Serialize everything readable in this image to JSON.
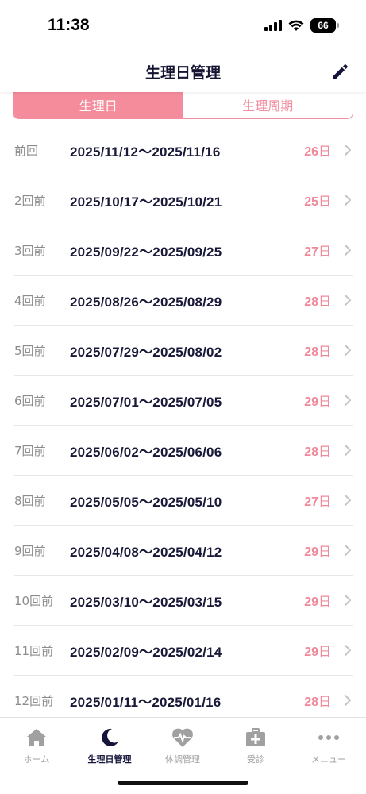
{
  "status": {
    "time": "11:38",
    "battery": "66"
  },
  "header": {
    "title": "生理日管理"
  },
  "segments": {
    "active": "生理日",
    "inactive": "生理周期"
  },
  "records": [
    {
      "label": "前回",
      "range": "2025/11/12〜2025/11/16",
      "days": "26",
      "unit": "日"
    },
    {
      "label": "2回前",
      "range": "2025/10/17〜2025/10/21",
      "days": "25",
      "unit": "日"
    },
    {
      "label": "3回前",
      "range": "2025/09/22〜2025/09/25",
      "days": "27",
      "unit": "日"
    },
    {
      "label": "4回前",
      "range": "2025/08/26〜2025/08/29",
      "days": "28",
      "unit": "日"
    },
    {
      "label": "5回前",
      "range": "2025/07/29〜2025/08/02",
      "days": "28",
      "unit": "日"
    },
    {
      "label": "6回前",
      "range": "2025/07/01〜2025/07/05",
      "days": "29",
      "unit": "日"
    },
    {
      "label": "7回前",
      "range": "2025/06/02〜2025/06/06",
      "days": "28",
      "unit": "日"
    },
    {
      "label": "8回前",
      "range": "2025/05/05〜2025/05/10",
      "days": "27",
      "unit": "日"
    },
    {
      "label": "9回前",
      "range": "2025/04/08〜2025/04/12",
      "days": "29",
      "unit": "日"
    },
    {
      "label": "10回前",
      "range": "2025/03/10〜2025/03/15",
      "days": "29",
      "unit": "日"
    },
    {
      "label": "11回前",
      "range": "2025/02/09〜2025/02/14",
      "days": "29",
      "unit": "日"
    },
    {
      "label": "12回前",
      "range": "2025/01/11〜2025/01/16",
      "days": "28",
      "unit": "日"
    }
  ],
  "tabbar": {
    "home": "ホーム",
    "period": "生理日管理",
    "condition": "体調管理",
    "clinic": "受診",
    "menu": "メニュー"
  },
  "colors": {
    "accent": "#f48c9c",
    "navy": "#14143a",
    "muted": "#a0a0a0"
  },
  "icons": {
    "edit": "pencil-icon",
    "row": "chevron-right-icon",
    "home": "house-icon",
    "period": "moon-icon",
    "condition": "heart-pulse-icon",
    "clinic": "medical-bag-icon",
    "menu": "dots-icon"
  }
}
